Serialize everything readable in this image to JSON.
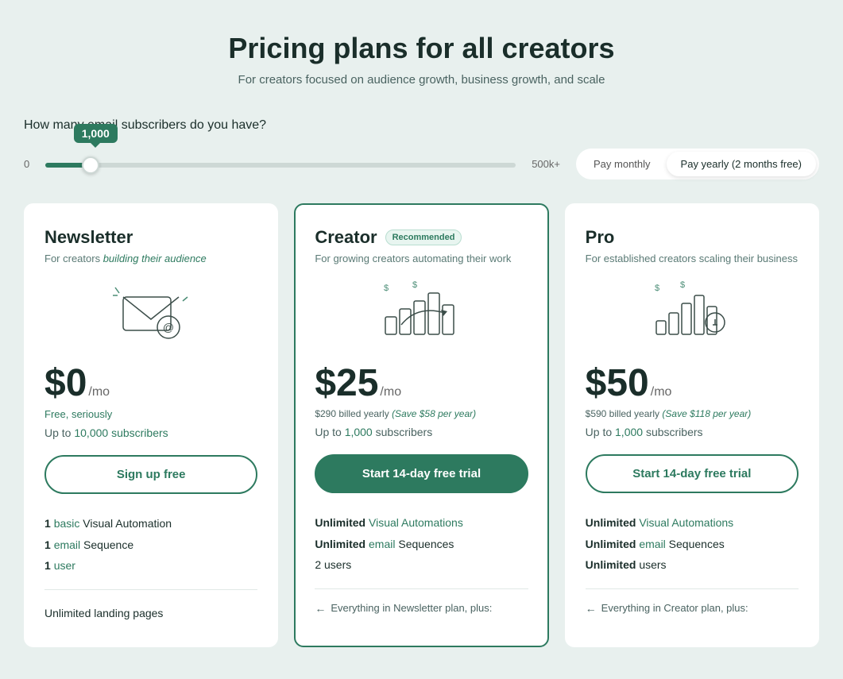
{
  "header": {
    "title": "Pricing plans for all creators",
    "subtitle": "For creators focused on audience growth, business growth, and scale"
  },
  "slider": {
    "label": "How many email subscribers do you have?",
    "min": "0",
    "max": "500k+",
    "tooltip_value": "1,000",
    "value": "8"
  },
  "billing": {
    "monthly_label": "Pay monthly",
    "yearly_label": "Pay yearly (2 months free)",
    "active": "yearly"
  },
  "plans": [
    {
      "id": "newsletter",
      "title": "Newsletter",
      "subtitle_plain": "For creators ",
      "subtitle_link": "building their audience",
      "price": "$0",
      "period": "/mo",
      "free_label": "Free, seriously",
      "billing_note": "",
      "subscribers": "Up to ",
      "subscribers_highlight": "10,000",
      "subscribers_suffix": " subscribers",
      "cta_label": "Sign up free",
      "cta_type": "outline",
      "recommended": false,
      "features": [
        {
          "bold": "1 ",
          "link": "basic",
          "rest": "Visual Automation"
        },
        {
          "bold": "1 ",
          "link": "email",
          "rest": " Sequence"
        },
        {
          "bold": "1 ",
          "link": "user",
          "rest": ""
        }
      ],
      "divider": true,
      "footer": "Unlimited landing pages",
      "everything_note": ""
    },
    {
      "id": "creator",
      "title": "Creator",
      "subtitle_plain": "For growing creators automating their work",
      "subtitle_link": "",
      "price": "$25",
      "period": "/mo",
      "free_label": "",
      "billing_note": "$290 billed yearly ",
      "billing_save": "(Save $58 per year)",
      "subscribers": "Up to ",
      "subscribers_highlight": "1,000",
      "subscribers_suffix": " subscribers",
      "cta_label": "Start 14-day free trial",
      "cta_type": "filled",
      "recommended": true,
      "features": [
        {
          "bold": "Unlimited ",
          "link": "Visual Automations",
          "rest": ""
        },
        {
          "bold": "Unlimited ",
          "link": "email",
          "rest": " Sequences"
        },
        {
          "bold": "2 ",
          "link": "",
          "rest": "users"
        }
      ],
      "divider": true,
      "footer": "",
      "everything_note": "Everything in Newsletter plan, plus:"
    },
    {
      "id": "pro",
      "title": "Pro",
      "subtitle_plain": "For established creators scaling their business",
      "subtitle_link": "",
      "price": "$50",
      "period": "/mo",
      "free_label": "",
      "billing_note": "$590 billed yearly ",
      "billing_save": "(Save $118 per year)",
      "subscribers": "Up to ",
      "subscribers_highlight": "1,000",
      "subscribers_suffix": " subscribers",
      "cta_label": "Start 14-day free trial",
      "cta_type": "outline",
      "recommended": false,
      "features": [
        {
          "bold": "Unlimited ",
          "link": "Visual Automations",
          "rest": ""
        },
        {
          "bold": "Unlimited ",
          "link": "email",
          "rest": " Sequences"
        },
        {
          "bold": "Unlimited ",
          "link": "",
          "rest": "users"
        }
      ],
      "divider": true,
      "footer": "",
      "everything_note": "Everything in Creator plan, plus:"
    }
  ]
}
